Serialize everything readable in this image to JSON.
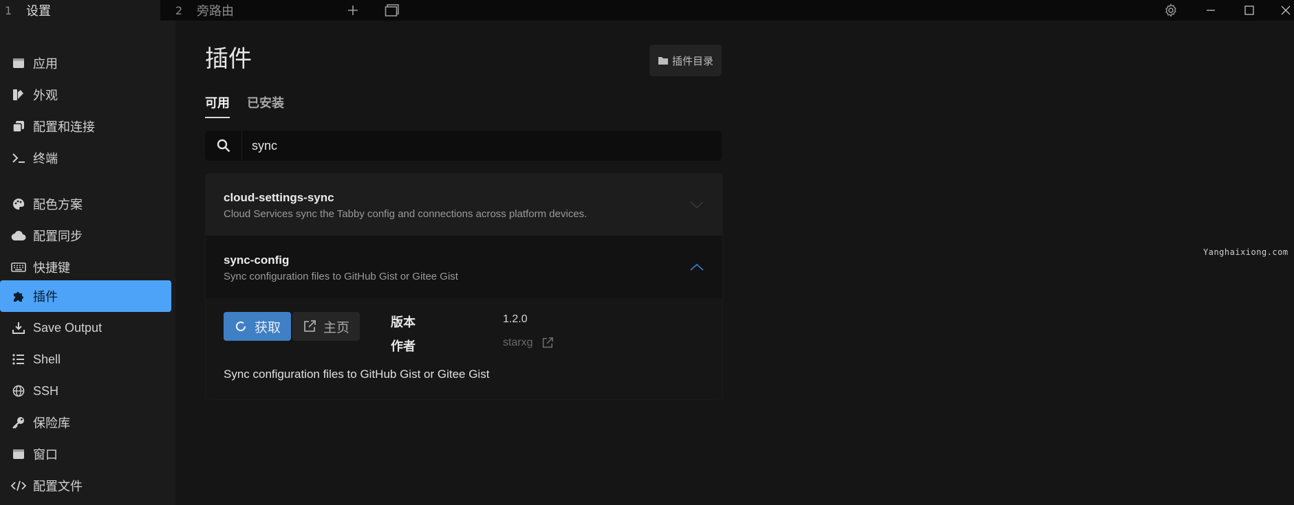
{
  "titlebar": {
    "tabs": [
      {
        "num": "1",
        "title": "设置"
      },
      {
        "num": "2",
        "title": "旁路由"
      }
    ],
    "icons": [
      "plus-icon",
      "window-icon",
      "gear-icon",
      "minimize-icon",
      "maximize-icon",
      "close-icon"
    ]
  },
  "sidebar": {
    "items": [
      {
        "label": "应用",
        "icon": "window-icon"
      },
      {
        "label": "外观",
        "icon": "palette-swatch-icon"
      },
      {
        "label": "配置和连接",
        "icon": "copy-icon"
      },
      {
        "label": "终端",
        "icon": "terminal-icon"
      },
      {
        "label": "配色方案",
        "icon": "palette-icon"
      },
      {
        "label": "配置同步",
        "icon": "cloud-icon"
      },
      {
        "label": "快捷键",
        "icon": "keyboard-icon"
      },
      {
        "label": "插件",
        "icon": "puzzle-icon",
        "active": true
      },
      {
        "label": "Save Output",
        "icon": "download-icon"
      },
      {
        "label": "Shell",
        "icon": "list-icon"
      },
      {
        "label": "SSH",
        "icon": "globe-icon"
      },
      {
        "label": "保险库",
        "icon": "key-icon"
      },
      {
        "label": "窗口",
        "icon": "window-icon"
      },
      {
        "label": "配置文件",
        "icon": "code-icon"
      }
    ]
  },
  "main": {
    "title": "插件",
    "dir_button": "插件目录",
    "tabs": [
      {
        "label": "可用",
        "active": true
      },
      {
        "label": "已安装",
        "active": false
      }
    ],
    "search": {
      "value": "sync"
    },
    "plugins": [
      {
        "name": "cloud-settings-sync",
        "description": "Cloud Services sync the Tabby config and connections across platform devices.",
        "expanded": false
      },
      {
        "name": "sync-config",
        "description": "Sync configuration files to GitHub Gist or Gitee Gist",
        "expanded": true
      }
    ],
    "details": {
      "get_label": "获取",
      "home_label": "主页",
      "version_key": "版本",
      "version_value": "1.2.0",
      "author_key": "作者",
      "author_value": "starxg",
      "long_description": "Sync configuration files to GitHub Gist or Gitee Gist"
    }
  },
  "watermark": "Yanghaixiong.com",
  "colors": {
    "accent": "#4da3f7",
    "button_primary": "#3f7fc4",
    "chevron_active": "#3a82d6"
  }
}
